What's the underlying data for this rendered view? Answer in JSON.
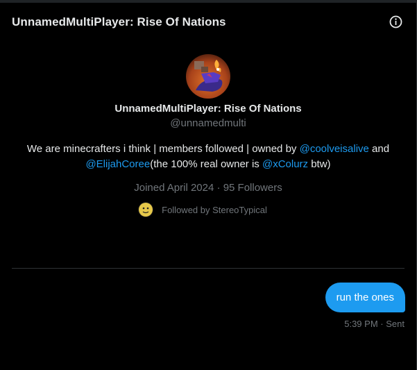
{
  "header": {
    "title": "UnnamedMultiPlayer: Rise Of Nations",
    "info_icon": "info-circle-icon"
  },
  "profile": {
    "name": "UnnamedMultiPlayer: Rise Of Nations",
    "handle": "@unnamedmulti",
    "bio": {
      "part1": "We are minecrafters i think | members followed | owned by ",
      "mention1": "@coolveisalive",
      "part2": " and ",
      "mention2": "@ElijahCoree",
      "part3": "(the 100% real owner is ",
      "mention3": "@xColurz",
      "part4": " btw)"
    },
    "joined": "Joined April 2024",
    "separator": "·",
    "followers": "95 Followers",
    "followed_by": "Followed by StereoTypical"
  },
  "message": {
    "text": "run the ones",
    "time": "5:39 PM",
    "separator": "·",
    "status": "Sent"
  },
  "colors": {
    "accent": "#1d9bf0",
    "muted": "#71767b",
    "background": "#000000",
    "text": "#e7e9ea"
  }
}
